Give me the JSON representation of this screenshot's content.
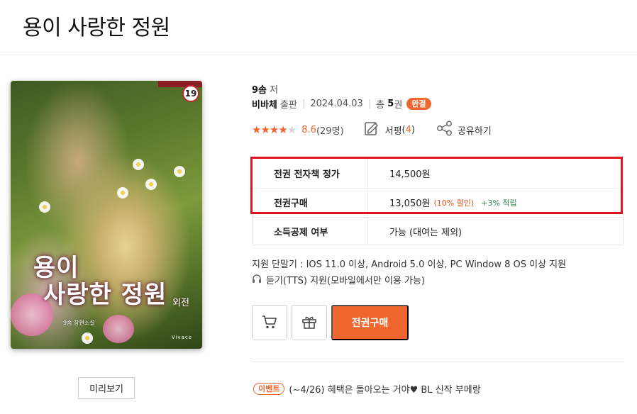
{
  "title": "용이 사랑한 정원",
  "cover": {
    "art_title_line1": "용이",
    "art_title_line2": "사랑한 정원",
    "art_subtitle": "외전",
    "art_author": "9솜 장편소설",
    "art_publisher": "Vivace",
    "age_badge": "19"
  },
  "preview_label": "미리보기",
  "author": {
    "name": "9솜",
    "role": "저"
  },
  "publisher": {
    "name": "비바체",
    "role": "출판",
    "date": "2024.04.03",
    "volumes_prefix": "총",
    "volumes_count": "5",
    "volumes_unit": "권",
    "status_badge": "완결"
  },
  "rating": {
    "stars_filled": 4,
    "stars_total": 5,
    "score": "8.6",
    "count": "(29명)"
  },
  "reviews": {
    "label": "서평",
    "count": "4",
    "open": "(",
    "close": ")"
  },
  "share_label": "공유하기",
  "price_table": [
    {
      "label": "전권 전자책 정가",
      "value": "14,500원"
    },
    {
      "label": "전권구매",
      "value": "13,050원",
      "discount": "(10% 할인)",
      "points": "+3% 적립"
    },
    {
      "label": "소득공제 여부",
      "value": "가능 (대여는 제외)"
    }
  ],
  "support": {
    "devices": "지원 단말기 : IOS 11.0 이상, Android 5.0 이상, PC Window 8 OS 이상 지원",
    "tts": "듣기(TTS) 지원(모바일에서만 이용 가능)"
  },
  "actions": {
    "buy_all_label": "전권구매"
  },
  "event": {
    "badge": "이벤트",
    "text": "(~4/26) 혜택은 돌아오는 거야♥ BL 신작 부메랑"
  },
  "colors": {
    "accent": "#f0662f",
    "highlight": "#e41521",
    "points": "#2f8a4c"
  },
  "icons": [
    "cart-icon",
    "gift-icon",
    "review-icon",
    "share-icon",
    "headphones-icon",
    "star-icon"
  ]
}
